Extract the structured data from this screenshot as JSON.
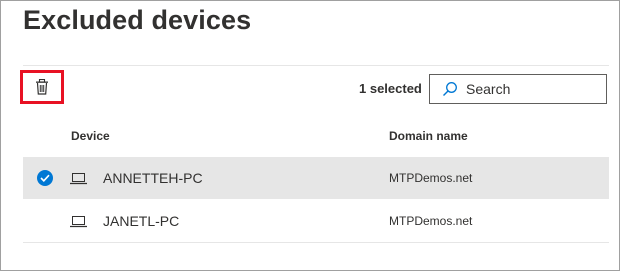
{
  "panel": {
    "title": "Excluded devices"
  },
  "toolbar": {
    "delete_icon": "trash-icon",
    "selected_count": "1 selected",
    "search_placeholder": "Search",
    "search_icon": "search-icon"
  },
  "table": {
    "columns": [
      "Device",
      "Domain name"
    ],
    "rows": [
      {
        "selected": true,
        "device_icon": "laptop-icon",
        "device": "ANNETTEH-PC",
        "domain": "MTPDemos.net"
      },
      {
        "selected": false,
        "device_icon": "laptop-icon",
        "device": "JANETL-PC",
        "domain": "MTPDemos.net"
      }
    ]
  },
  "colors": {
    "accent": "#0078d4",
    "highlight_border": "#e81123",
    "selected_row": "#e6e6e6",
    "text": "#323130"
  }
}
